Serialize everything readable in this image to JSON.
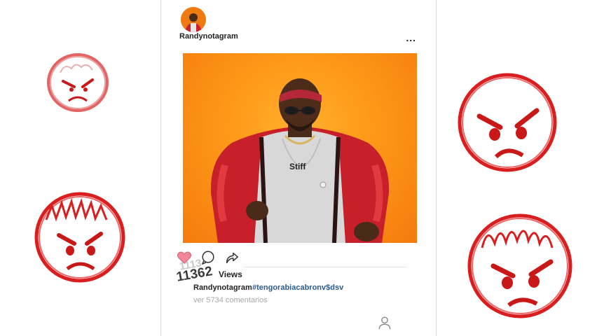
{
  "post": {
    "username": "Randynotagram",
    "more_label": "...",
    "views_count_ghost": "1113",
    "views_count": "11362",
    "views_label": "Views",
    "caption_username": "Randynotagram",
    "caption_hashtag": "#tengorabiacabronv$dsv",
    "comments_link": "ver 5734 comentarios",
    "shirt_text": "Stiff",
    "liked": true
  },
  "icons": {
    "like": "heart-icon",
    "comment": "comment-bubble-icon",
    "share": "share-arrow-icon",
    "profile": "person-icon"
  },
  "colors": {
    "like": "#f4869a",
    "photo_background": "#ff9a1a",
    "hashtag": "#2b5a8c",
    "doodle_red": "#d81e1e"
  }
}
